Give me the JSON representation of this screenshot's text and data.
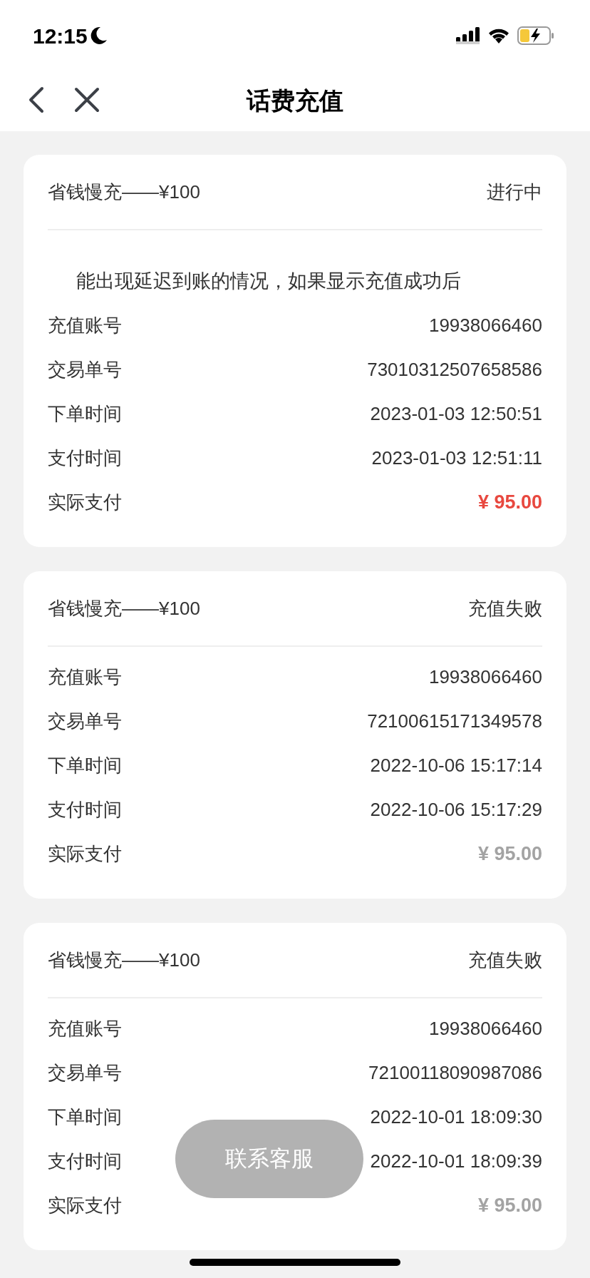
{
  "status_bar": {
    "time": "12:15"
  },
  "nav": {
    "title": "话费充值"
  },
  "orders": [
    {
      "product": "省钱慢充——¥100",
      "status": "进行中",
      "kind": "in_progress",
      "notice": "能出现延迟到账的情况，如果显示充值成功后",
      "fields": [
        {
          "label": "充值账号",
          "value": "19938066460"
        },
        {
          "label": "交易单号",
          "value": "73010312507658586"
        },
        {
          "label": "下单时间",
          "value": "2023-01-03 12:50:51"
        },
        {
          "label": "支付时间",
          "value": "2023-01-03 12:51:11"
        }
      ],
      "paid_label": "实际支付",
      "paid": "¥ 95.00"
    },
    {
      "product": "省钱慢充——¥100",
      "status": "充值失败",
      "kind": "failed",
      "fields": [
        {
          "label": "充值账号",
          "value": "19938066460"
        },
        {
          "label": "交易单号",
          "value": "72100615171349578"
        },
        {
          "label": "下单时间",
          "value": "2022-10-06 15:17:14"
        },
        {
          "label": "支付时间",
          "value": "2022-10-06 15:17:29"
        }
      ],
      "paid_label": "实际支付",
      "paid": "¥ 95.00"
    },
    {
      "product": "省钱慢充——¥100",
      "status": "充值失败",
      "kind": "failed",
      "fields": [
        {
          "label": "充值账号",
          "value": "19938066460"
        },
        {
          "label": "交易单号",
          "value": "72100118090987086"
        },
        {
          "label": "下单时间",
          "value": "2022-10-01 18:09:30"
        },
        {
          "label": "支付时间",
          "value": "2022-10-01 18:09:39"
        }
      ],
      "paid_label": "实际支付",
      "paid": "¥ 95.00"
    }
  ],
  "contact_button": "联系客服"
}
